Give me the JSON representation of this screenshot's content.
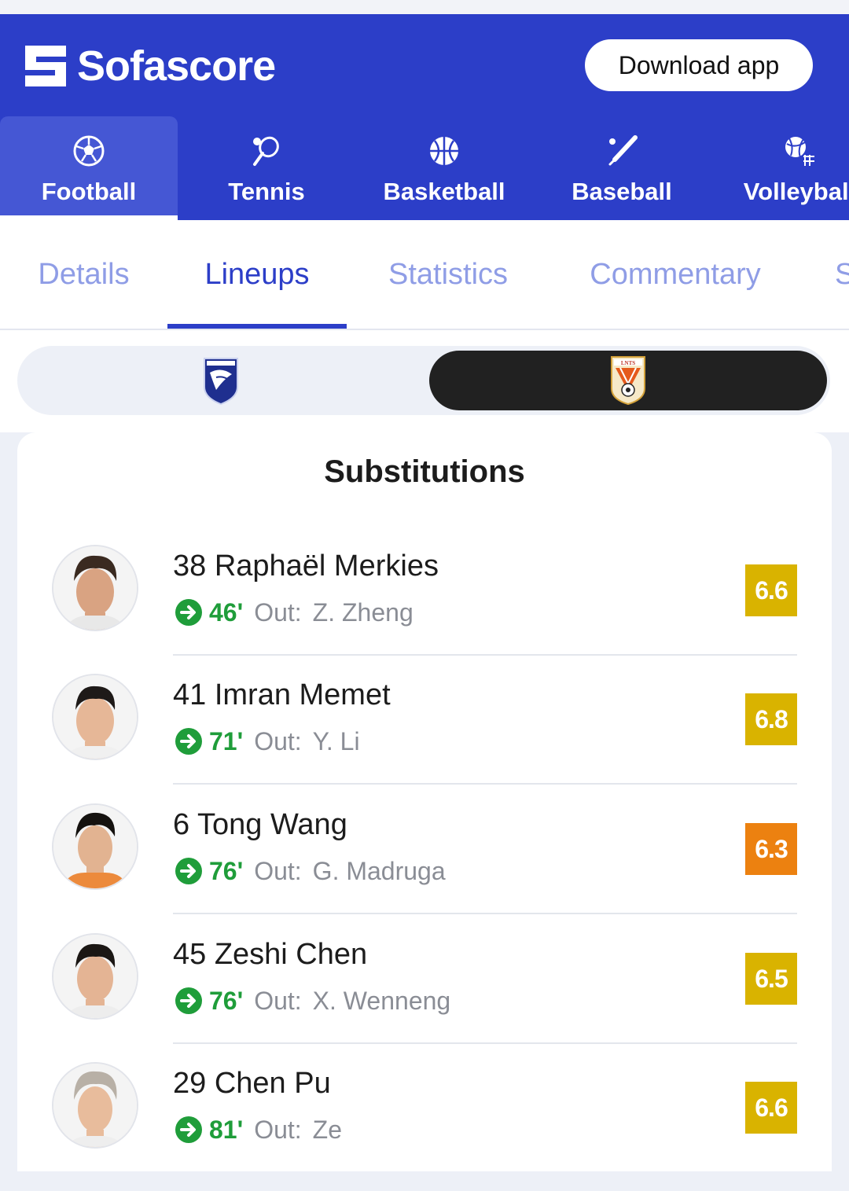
{
  "brand": {
    "name": "Sofascore",
    "header_color": "#2c3ec8"
  },
  "header": {
    "download_label": "Download app"
  },
  "sports": [
    {
      "label": "Football",
      "icon": "football-icon",
      "active": true
    },
    {
      "label": "Tennis",
      "icon": "tennis-icon"
    },
    {
      "label": "Basketball",
      "icon": "basketball-icon"
    },
    {
      "label": "Baseball",
      "icon": "baseball-icon"
    },
    {
      "label": "Volleyball",
      "icon": "volleyball-icon"
    }
  ],
  "tabs": [
    {
      "label": "Details"
    },
    {
      "label": "Lineups",
      "active": true
    },
    {
      "label": "Statistics"
    },
    {
      "label": "Commentary"
    },
    {
      "label": "S"
    }
  ],
  "teams": {
    "home_icon": "home-team-crest",
    "away_icon": "away-team-crest",
    "selected": "away"
  },
  "substitutions": {
    "title": "Substitutions",
    "out_label": "Out:",
    "items": [
      {
        "number_name": "38 Raphaël Merkies",
        "minute": "46'",
        "out": "Z. Zheng",
        "rating": "6.6",
        "rating_color": "#d9b300"
      },
      {
        "number_name": "41 Imran Memet",
        "minute": "71'",
        "out": "Y. Li",
        "rating": "6.8",
        "rating_color": "#d9b300"
      },
      {
        "number_name": "6 Tong Wang",
        "minute": "76'",
        "out": "G. Madruga",
        "rating": "6.3",
        "rating_color": "#ec8110"
      },
      {
        "number_name": "45 Zeshi Chen",
        "minute": "76'",
        "out": "X. Wenneng",
        "rating": "6.5",
        "rating_color": "#d9b300"
      },
      {
        "number_name": "29 Chen Pu",
        "minute": "81'",
        "out": "Ze",
        "rating": "6.6",
        "rating_color": "#d9b300"
      }
    ]
  }
}
